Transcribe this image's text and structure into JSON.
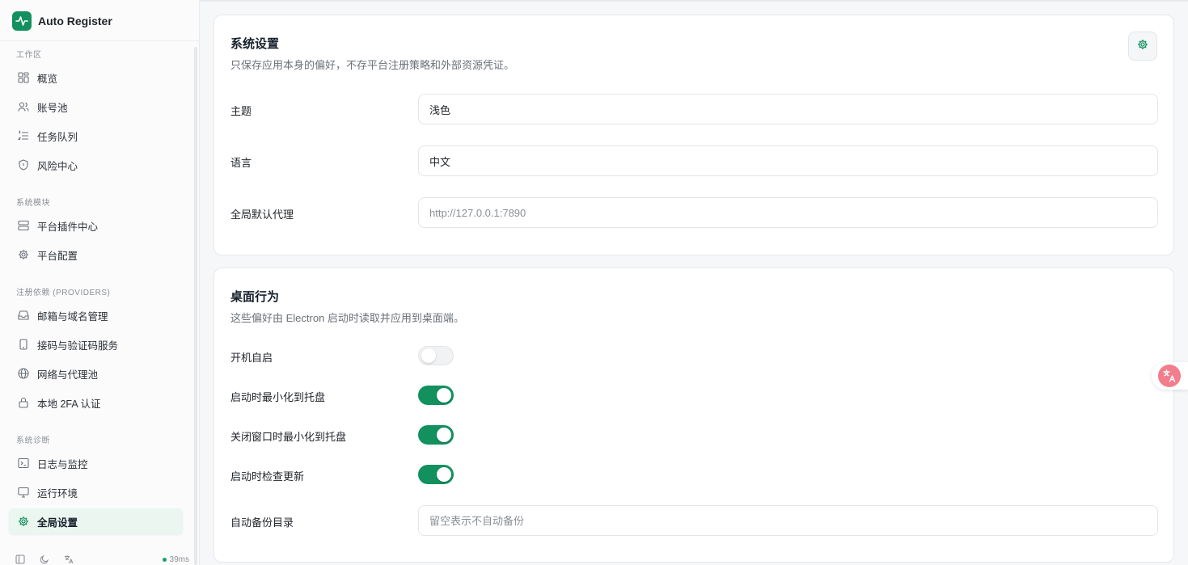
{
  "app": {
    "title": "Auto Register"
  },
  "sidebar": {
    "sections": [
      {
        "label": "工作区",
        "items": [
          {
            "label": "概览",
            "icon": "dashboard-icon"
          },
          {
            "label": "账号池",
            "icon": "users-icon"
          },
          {
            "label": "任务队列",
            "icon": "list-icon"
          },
          {
            "label": "风险中心",
            "icon": "shield-icon"
          }
        ]
      },
      {
        "label": "系统模块",
        "items": [
          {
            "label": "平台插件中心",
            "icon": "server-icon"
          },
          {
            "label": "平台配置",
            "icon": "gear-icon"
          }
        ]
      },
      {
        "label": "注册依赖 (PROVIDERS)",
        "items": [
          {
            "label": "邮箱与域名管理",
            "icon": "inbox-icon"
          },
          {
            "label": "接码与验证码服务",
            "icon": "phone-icon"
          },
          {
            "label": "网络与代理池",
            "icon": "globe-icon"
          },
          {
            "label": "本地 2FA 认证",
            "icon": "lock-icon"
          }
        ]
      },
      {
        "label": "系统诊断",
        "items": [
          {
            "label": "日志与监控",
            "icon": "terminal-icon"
          },
          {
            "label": "运行环境",
            "icon": "monitor-icon"
          },
          {
            "label": "全局设置",
            "icon": "gear-icon",
            "active": true
          }
        ]
      }
    ],
    "footer": {
      "latency": "39ms",
      "status_color": "#16a06a"
    }
  },
  "system_settings": {
    "title": "系统设置",
    "description": "只保存应用本身的偏好，不存平台注册策略和外部资源凭证。",
    "theme": {
      "label": "主题",
      "value": "浅色"
    },
    "language": {
      "label": "语言",
      "value": "中文"
    },
    "proxy": {
      "label": "全局默认代理",
      "value": "",
      "placeholder": "http://127.0.0.1:7890"
    }
  },
  "desktop_behavior": {
    "title": "桌面行为",
    "description": "这些偏好由 Electron 启动时读取并应用到桌面端。",
    "autostart": {
      "label": "开机自启",
      "enabled": false
    },
    "minimize_on_start": {
      "label": "启动时最小化到托盘",
      "enabled": true
    },
    "minimize_on_close": {
      "label": "关闭窗口时最小化到托盘",
      "enabled": true
    },
    "check_updates": {
      "label": "启动时检查更新",
      "enabled": true
    },
    "backup_dir": {
      "label": "自动备份目录",
      "value": "",
      "placeholder": "留空表示不自动备份"
    }
  },
  "colors": {
    "accent": "#12915f",
    "active_bg": "#eaf6ef",
    "translate_badge": "#f27d8c"
  }
}
